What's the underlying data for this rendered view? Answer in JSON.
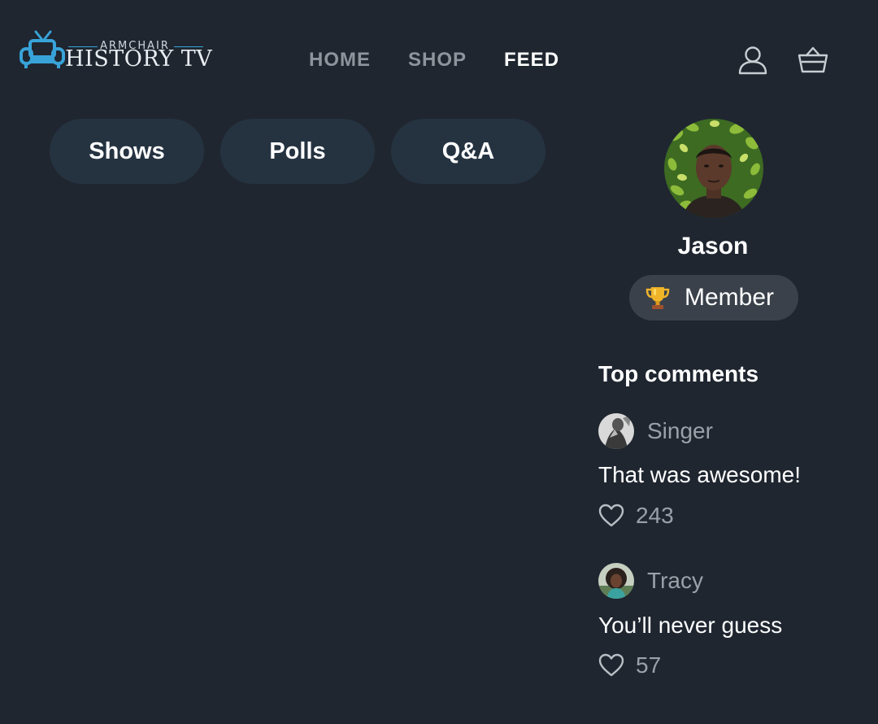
{
  "brand": {
    "logo_top_text": "ARMCHAIR",
    "logo_main_text": "HISTORY TV",
    "accent_color": "#38a3d8"
  },
  "nav": {
    "items": [
      {
        "label": "HOME",
        "active": false
      },
      {
        "label": "SHOP",
        "active": false
      },
      {
        "label": "FEED",
        "active": true
      }
    ]
  },
  "header_icons": [
    "user-icon",
    "basket-icon"
  ],
  "filters": {
    "pills": [
      {
        "label": "Shows"
      },
      {
        "label": "Polls"
      },
      {
        "label": "Q&A"
      }
    ]
  },
  "profile": {
    "name": "Jason",
    "badge_icon": "trophy-icon",
    "badge_label": "Member"
  },
  "top_comments": {
    "title": "Top comments",
    "comments": [
      {
        "user": "Singer",
        "text": "That was awesome!",
        "likes": "243"
      },
      {
        "user": "Tracy",
        "text": "You’ll never guess",
        "likes": "57"
      }
    ]
  }
}
